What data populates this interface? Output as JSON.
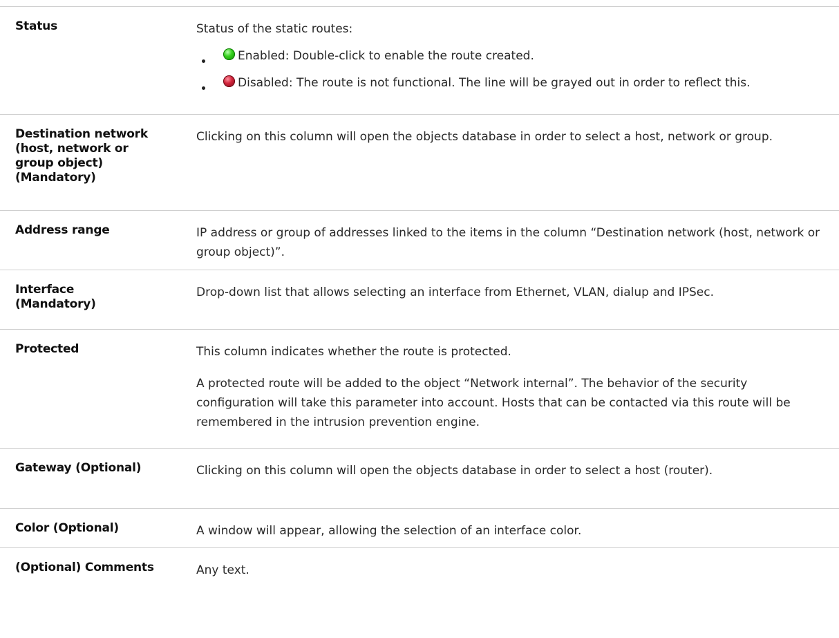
{
  "rows": [
    {
      "term": "Status",
      "desc_intro": "Status of the static routes:",
      "bullets": [
        {
          "icon": "green-status-icon",
          "color": "#2fc41b",
          "text": "Enabled: Double-click to enable the route created."
        },
        {
          "icon": "red-status-icon",
          "color": "#c21a31",
          "text": "Disabled: The route is not functional. The line will be grayed out in order to reflect this."
        }
      ]
    },
    {
      "term_lines": [
        "Destination network",
        "(host, network or",
        "group object)",
        "(Mandatory)"
      ],
      "desc": "Clicking on this column will open the objects database in order to select a host, network or group."
    },
    {
      "term": "Address range",
      "desc": "IP address or group of addresses linked to the items in the column “Destination network (host, network or group object)”."
    },
    {
      "term_lines": [
        "Interface",
        "(Mandatory)"
      ],
      "desc": "Drop-down list  that allows selecting an interface from Ethernet, VLAN, dialup and IPSec."
    },
    {
      "term": "Protected",
      "desc_paragraphs": [
        "This column indicates whether the route is protected.",
        "A protected route will be added to the object “Network internal”. The behavior of the security configuration will take this parameter into account. Hosts that can be contacted via this route will be remembered in the intrusion prevention engine."
      ]
    },
    {
      "term": "Gateway (Optional)",
      "desc": "Clicking on this column will open the objects database in order to select a host (router)."
    },
    {
      "term": "Color (Optional)",
      "desc": "A window will appear, allowing the selection of an interface color."
    },
    {
      "term": "(Optional) Comments",
      "desc": "Any text."
    }
  ]
}
